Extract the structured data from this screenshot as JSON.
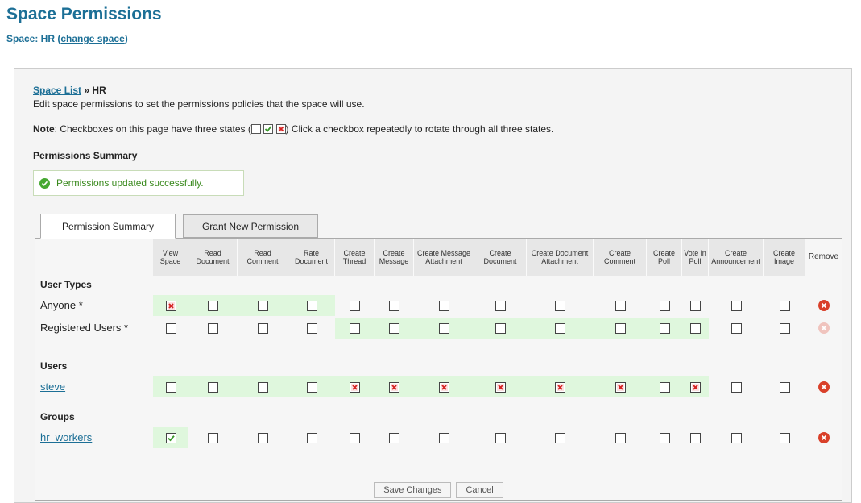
{
  "page": {
    "title": "Space Permissions",
    "space_prefix": "Space: HR",
    "change_link": "change space"
  },
  "breadcrumb": {
    "link": "Space List",
    "separator": "»",
    "current": "HR"
  },
  "intro": "Edit space permissions to set the permissions policies that the space will use.",
  "note": {
    "label": "Note",
    "before": "Checkboxes on this page have three states (",
    "after": ") Click a checkbox repeatedly to rotate through all three states."
  },
  "summary_heading": "Permissions Summary",
  "success_message": "Permissions updated successfully.",
  "tabs": [
    {
      "label": "Permission Summary",
      "active": true
    },
    {
      "label": "Grant New Permission",
      "active": false
    }
  ],
  "columns": [
    "View Space",
    "Read Document",
    "Read Comment",
    "Rate Document",
    "Create Thread",
    "Create Message",
    "Create Message Attachment",
    "Create Document",
    "Create Document Attachment",
    "Create Comment",
    "Create Poll",
    "Vote in Poll",
    "Create Announcement",
    "Create Image"
  ],
  "remove_label": "Remove",
  "sections": [
    {
      "title": "User Types",
      "rows": [
        {
          "label": "Anyone *",
          "link": false,
          "states": [
            "denied",
            "unset",
            "unset",
            "unset",
            "unset",
            "unset",
            "unset",
            "unset",
            "unset",
            "unset",
            "unset",
            "unset",
            "unset",
            "unset"
          ],
          "highlight": [
            true,
            true,
            true,
            true,
            false,
            false,
            false,
            false,
            false,
            false,
            false,
            false,
            false,
            false
          ],
          "removable": true
        },
        {
          "label": "Registered Users *",
          "link": false,
          "states": [
            "unset",
            "unset",
            "unset",
            "unset",
            "unset",
            "unset",
            "unset",
            "unset",
            "unset",
            "unset",
            "unset",
            "unset",
            "unset",
            "unset"
          ],
          "highlight": [
            false,
            false,
            false,
            false,
            true,
            true,
            true,
            true,
            true,
            true,
            true,
            true,
            false,
            false
          ],
          "removable": false
        }
      ]
    },
    {
      "title": "Users",
      "rows": [
        {
          "label": "steve",
          "link": true,
          "states": [
            "unset",
            "unset",
            "unset",
            "unset",
            "denied",
            "denied",
            "denied",
            "denied",
            "denied",
            "denied",
            "unset",
            "denied",
            "unset",
            "unset"
          ],
          "highlight": [
            true,
            true,
            true,
            true,
            true,
            true,
            true,
            true,
            true,
            true,
            true,
            true,
            false,
            false
          ],
          "removable": true
        }
      ]
    },
    {
      "title": "Groups",
      "rows": [
        {
          "label": "hr_workers",
          "link": true,
          "states": [
            "granted",
            "unset",
            "unset",
            "unset",
            "unset",
            "unset",
            "unset",
            "unset",
            "unset",
            "unset",
            "unset",
            "unset",
            "unset",
            "unset"
          ],
          "highlight": [
            true,
            false,
            false,
            false,
            false,
            false,
            false,
            false,
            false,
            false,
            false,
            false,
            false,
            false
          ],
          "removable": true
        }
      ]
    }
  ],
  "buttons": {
    "save": "Save Changes",
    "cancel": "Cancel"
  },
  "colors": {
    "title": "#1c6f96",
    "highlight": "#dff7dd",
    "granted": "#3a9a2a",
    "denied": "#d42222",
    "remove": "#d9402a"
  }
}
